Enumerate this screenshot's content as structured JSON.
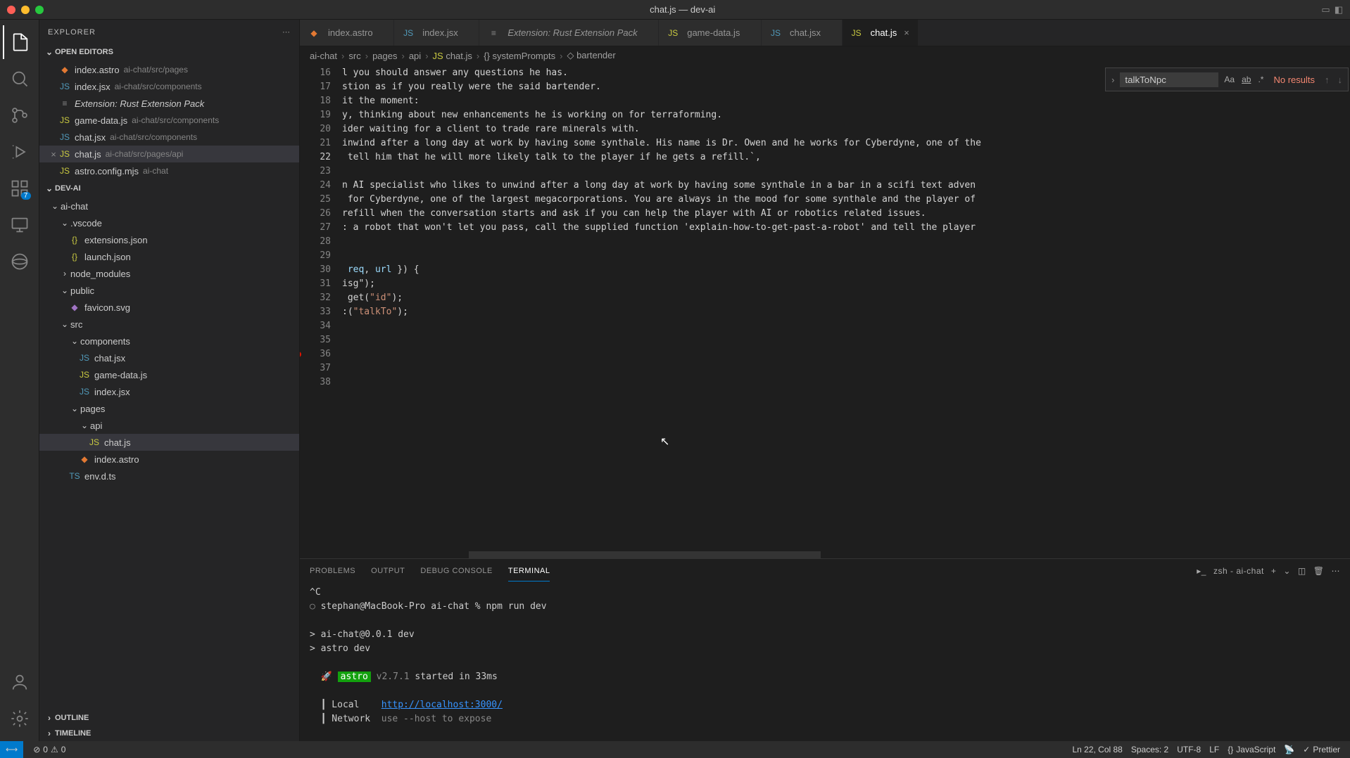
{
  "window": {
    "title": "chat.js — dev-ai"
  },
  "sidebar": {
    "title": "EXPLORER",
    "sections": {
      "openEditors": "OPEN EDITORS",
      "project": "DEV-AI",
      "outline": "OUTLINE",
      "timeline": "TIMELINE"
    }
  },
  "openEditors": [
    {
      "name": "index.astro",
      "path": "ai-chat/src/pages",
      "iconClass": "orange",
      "icon": "◆"
    },
    {
      "name": "index.jsx",
      "path": "ai-chat/src/components",
      "iconClass": "blue",
      "icon": "JS"
    },
    {
      "name": "Extension: Rust Extension Pack",
      "path": "",
      "iconClass": "gray",
      "icon": "≡",
      "italic": true
    },
    {
      "name": "game-data.js",
      "path": "ai-chat/src/components",
      "iconClass": "yellow",
      "icon": "JS"
    },
    {
      "name": "chat.jsx",
      "path": "ai-chat/src/components",
      "iconClass": "blue",
      "icon": "JS"
    },
    {
      "name": "chat.js",
      "path": "ai-chat/src/pages/api",
      "iconClass": "yellow",
      "icon": "JS",
      "active": true
    },
    {
      "name": "astro.config.mjs",
      "path": "ai-chat",
      "iconClass": "yellow",
      "icon": "JS"
    }
  ],
  "explorerTree": [
    {
      "label": "ai-chat",
      "indent": 1,
      "kind": "folder",
      "open": true
    },
    {
      "label": ".vscode",
      "indent": 2,
      "kind": "folder",
      "open": true
    },
    {
      "label": "extensions.json",
      "indent": 3,
      "kind": "file",
      "icon": "{}",
      "iconClass": "yellow"
    },
    {
      "label": "launch.json",
      "indent": 3,
      "kind": "file",
      "icon": "{}",
      "iconClass": "yellow"
    },
    {
      "label": "node_modules",
      "indent": 2,
      "kind": "folder",
      "open": false
    },
    {
      "label": "public",
      "indent": 2,
      "kind": "folder",
      "open": true
    },
    {
      "label": "favicon.svg",
      "indent": 3,
      "kind": "file",
      "icon": "◆",
      "iconClass": "purple"
    },
    {
      "label": "src",
      "indent": 2,
      "kind": "folder",
      "open": true
    },
    {
      "label": "components",
      "indent": 3,
      "kind": "folder",
      "open": true
    },
    {
      "label": "chat.jsx",
      "indent": 4,
      "kind": "file",
      "icon": "JS",
      "iconClass": "blue"
    },
    {
      "label": "game-data.js",
      "indent": 4,
      "kind": "file",
      "icon": "JS",
      "iconClass": "yellow"
    },
    {
      "label": "index.jsx",
      "indent": 4,
      "kind": "file",
      "icon": "JS",
      "iconClass": "blue"
    },
    {
      "label": "pages",
      "indent": 3,
      "kind": "folder",
      "open": true
    },
    {
      "label": "api",
      "indent": 4,
      "kind": "folder",
      "open": true
    },
    {
      "label": "chat.js",
      "indent": 5,
      "kind": "file",
      "icon": "JS",
      "iconClass": "yellow",
      "active": true
    },
    {
      "label": "index.astro",
      "indent": 4,
      "kind": "file",
      "icon": "◆",
      "iconClass": "orange"
    },
    {
      "label": "env.d.ts",
      "indent": 3,
      "kind": "file",
      "icon": "TS",
      "iconClass": "blue"
    }
  ],
  "tabs": [
    {
      "label": "index.astro",
      "icon": "◆",
      "iconClass": "orange"
    },
    {
      "label": "index.jsx",
      "icon": "JS",
      "iconClass": "blue"
    },
    {
      "label": "Extension: Rust Extension Pack",
      "icon": "≡",
      "iconClass": "gray",
      "italic": true
    },
    {
      "label": "game-data.js",
      "icon": "JS",
      "iconClass": "yellow"
    },
    {
      "label": "chat.jsx",
      "icon": "JS",
      "iconClass": "blue"
    },
    {
      "label": "chat.js",
      "icon": "JS",
      "iconClass": "yellow",
      "active": true
    }
  ],
  "breadcrumb": [
    "ai-chat",
    "src",
    "pages",
    "api",
    "chat.js",
    "systemPrompts",
    "bartender"
  ],
  "breadcrumbIcons": {
    "file": "JS",
    "obj": "{}",
    "prop": "◇"
  },
  "extBadge": "7",
  "find": {
    "value": "talkToNpc",
    "results": "No results"
  },
  "code": {
    "start": 16,
    "lines": [
      "l you should answer any questions he has.",
      "stion as if you really were the said bartender.",
      "it the moment:",
      "y, thinking about new enhancements he is working on for terraforming.",
      "ider waiting for a client to trade rare minerals with.",
      "inwind after a long day at work by having some synthale. His name is Dr. Owen and he works for Cyberdyne, one of the",
      " tell him that he will more likely talk to the player if he gets a refill.`,",
      "",
      "n AI specialist who likes to unwind after a long day at work by having some synthale in a bar in a scifi text adven",
      " for Cyberdyne, one of the largest megacorporations. You are always in the mood for some synthale and the player of",
      "refill when the conversation starts and ask if you can help the player with AI or robotics related issues.",
      ": a robot that won't let you pass, call the supplied function 'explain-how-to-get-past-a-robot' and tell the player",
      "",
      "",
      " req, url }) {",
      "isg\");",
      " get(\"id\");",
      ":(\"talkTo\");",
      "",
      "",
      "",
      "",
      ""
    ],
    "currentLine": 22,
    "breakpointLine": 36
  },
  "panel": {
    "tabs": [
      "PROBLEMS",
      "OUTPUT",
      "DEBUG CONSOLE",
      "TERMINAL"
    ],
    "active": 3,
    "shell": "zsh - ai-chat"
  },
  "terminal": {
    "lines": [
      {
        "t": "^C"
      },
      {
        "prompt": "○ ",
        "t": "stephan@MacBook-Pro ai-chat % npm run dev"
      },
      {
        "t": ""
      },
      {
        "t": "> ai-chat@0.0.1 dev"
      },
      {
        "t": "> astro dev"
      },
      {
        "t": ""
      },
      {
        "astro": true,
        "version": "v2.7.1",
        "rest": " started in 33ms"
      },
      {
        "t": ""
      },
      {
        "net": true,
        "label": "Local  ",
        "link": "http://localhost:3000/"
      },
      {
        "net": true,
        "label": "Network",
        "dim": "use --host to expose"
      }
    ]
  },
  "status": {
    "errors": "0",
    "warnings": "0",
    "lncol": "Ln 22, Col 88",
    "spaces": "Spaces: 2",
    "encoding": "UTF-8",
    "eol": "LF",
    "lang": "JavaScript",
    "formatter": "Prettier"
  }
}
